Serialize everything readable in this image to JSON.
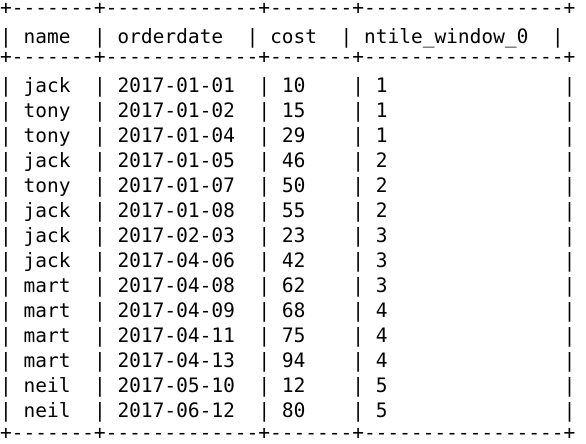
{
  "result_table": {
    "border_top": "+-------+-------------+-------+-----------------+",
    "border_header": "+-------+-------------+-------+-----------------+",
    "border_bottom": "+-------+-------------+-------+-----------------+",
    "columns": [
      "name",
      "orderdate",
      "cost",
      "ntile_window_0"
    ],
    "rows": [
      [
        "jack",
        "2017-01-01",
        "10",
        "1"
      ],
      [
        "tony",
        "2017-01-02",
        "15",
        "1"
      ],
      [
        "tony",
        "2017-01-04",
        "29",
        "1"
      ],
      [
        "jack",
        "2017-01-05",
        "46",
        "2"
      ],
      [
        "tony",
        "2017-01-07",
        "50",
        "2"
      ],
      [
        "jack",
        "2017-01-08",
        "55",
        "2"
      ],
      [
        "jack",
        "2017-02-03",
        "23",
        "3"
      ],
      [
        "jack",
        "2017-04-06",
        "42",
        "3"
      ],
      [
        "mart",
        "2017-04-08",
        "62",
        "3"
      ],
      [
        "mart",
        "2017-04-09",
        "68",
        "4"
      ],
      [
        "mart",
        "2017-04-11",
        "75",
        "4"
      ],
      [
        "mart",
        "2017-04-13",
        "94",
        "4"
      ],
      [
        "neil",
        "2017-05-10",
        "12",
        "5"
      ],
      [
        "neil",
        "2017-06-12",
        "80",
        "5"
      ]
    ]
  }
}
